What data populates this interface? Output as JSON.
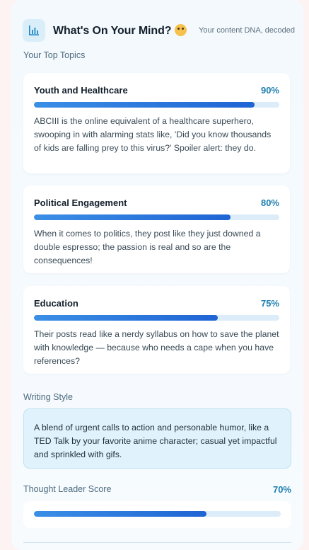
{
  "header": {
    "title": "What's On Your Mind?",
    "emoji_icon": "thinking-face-icon",
    "chart_icon": "bar-chart-icon",
    "subtitle": "Your content DNA, decoded"
  },
  "topics_section": {
    "label": "Your Top Topics",
    "items": [
      {
        "name": "Youth and Healthcare",
        "percent_label": "90%",
        "percent": 90,
        "description": "ABCIII is the online equivalent of a healthcare superhero, swooping in with alarming stats like, 'Did you know thousands of kids are falling prey to this virus?' Spoiler alert: they do."
      },
      {
        "name": "Political Engagement",
        "percent_label": "80%",
        "percent": 80,
        "description": "When it comes to politics, they post like they just downed a double espresso; the passion is real and so are the consequences!"
      },
      {
        "name": "Education",
        "percent_label": "75%",
        "percent": 75,
        "description": "Their posts read like a nerdy syllabus on how to save the planet with knowledge — because who needs a cape when you have references?"
      }
    ]
  },
  "writing_style": {
    "label": "Writing Style",
    "text": "A blend of urgent calls to action and personable humor, like a TED Talk by your favorite anime character; casual yet impactful and sprinkled with gifs."
  },
  "thought_leader": {
    "label": "Thought Leader Score",
    "percent_label": "70%",
    "percent": 70
  },
  "colors": {
    "accent": "#1e7fb0",
    "bar_start": "#3b8fe6",
    "bar_end": "#1f64d4",
    "track": "#dcecf8"
  }
}
